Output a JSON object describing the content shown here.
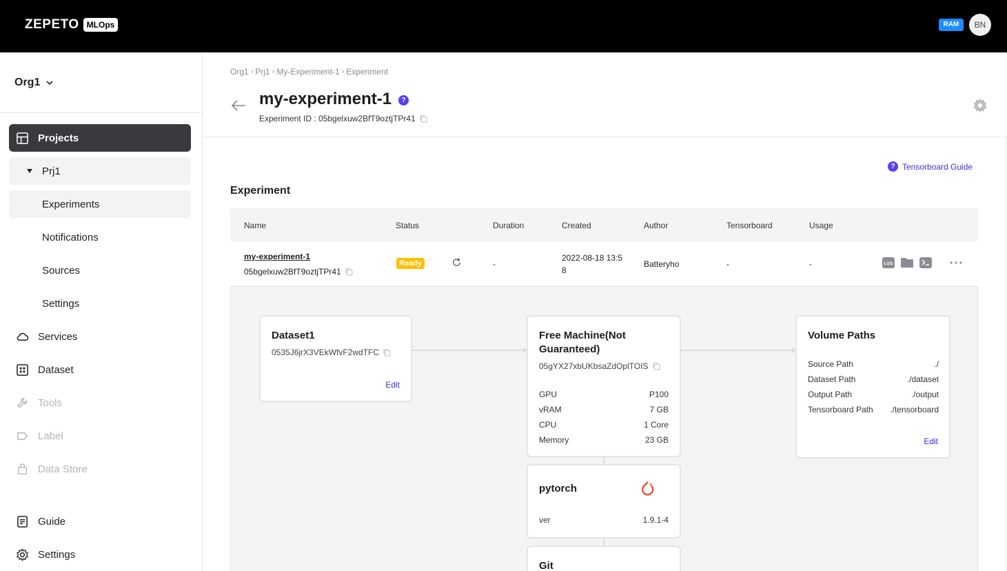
{
  "topbar": {
    "logo": "ZEPETO",
    "logo_badge": "MLOps",
    "ram_badge": "RAM",
    "avatar_initials": "BN"
  },
  "sidebar": {
    "org": "Org1",
    "projects": "Projects",
    "project_name": "Prj1",
    "project_sub": [
      "Experiments",
      "Notifications",
      "Sources",
      "Settings"
    ],
    "services": "Services",
    "dataset": "Dataset",
    "tools": "Tools",
    "label": "Label",
    "data_store": "Data Store",
    "guide": "Guide",
    "settings": "Settings"
  },
  "breadcrumb": [
    "Org1",
    "Prj1",
    "My-Experiment-1",
    "Experiment"
  ],
  "header": {
    "title": "my-experiment-1",
    "help": "?",
    "experiment_id_label": "Experiment ID : 05bgelxuw2BfT9oztjTPr41"
  },
  "guide_link": "Tensorboard Guide",
  "section_title": "Experiment",
  "table": {
    "columns": [
      "Name",
      "Status",
      "Duration",
      "Created",
      "Author",
      "Tensorboard",
      "Usage"
    ],
    "row": {
      "name": "my-experiment-1",
      "id": "05bgelxuw2BfT9oztjTPr41",
      "status": "Ready",
      "duration": "-",
      "created_line1": "2022-08-18 13:5",
      "created_line2": "8",
      "author": "Batteryho",
      "tensorboard": "-",
      "usage": "-"
    }
  },
  "flow": {
    "dataset": {
      "title": "Dataset1",
      "id": "0535J6jrX3VEkWfvF2wdTFC",
      "edit": "Edit"
    },
    "machine": {
      "title_line1": "Free Machine(Not",
      "title_line2": "Guaranteed)",
      "id": "05gYX27xbUKbsaZdOplTOIS",
      "specs": [
        {
          "k": "GPU",
          "v": "P100"
        },
        {
          "k": "vRAM",
          "v": "7 GB"
        },
        {
          "k": "CPU",
          "v": "1 Core"
        },
        {
          "k": "Memory",
          "v": "23 GB"
        }
      ]
    },
    "framework": {
      "title": "pytorch",
      "ver_label": "ver",
      "ver": "1.9.1-4"
    },
    "git": {
      "title": "Git"
    },
    "volume": {
      "title": "Volume Paths",
      "paths": [
        {
          "k": "Source Path",
          "v": "./"
        },
        {
          "k": "Dataset Path",
          "v": "./dataset"
        },
        {
          "k": "Output Path",
          "v": "./output"
        },
        {
          "k": "Tensorboard Path",
          "v": "./tensorboard"
        }
      ],
      "edit": "Edit"
    }
  },
  "colors": {
    "accent": "#5b3df5",
    "link": "#3b2fd6",
    "ready": "#ffbf00",
    "active_nav": "#3a3a3e",
    "pytorch": "#ee4c2c"
  }
}
